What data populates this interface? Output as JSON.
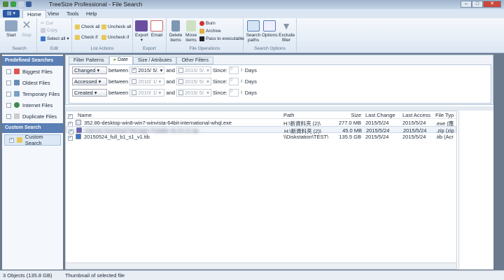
{
  "window": {
    "title": "TreeSize Professional - File Search"
  },
  "ribbon_tabs": [
    "Home",
    "View",
    "Tools",
    "Help"
  ],
  "ribbon": {
    "search": {
      "label": "Search",
      "start": "Start",
      "stop": "Stop"
    },
    "edit": {
      "label": "Edit",
      "cut": "Cut",
      "copy": "Copy",
      "select_all": "Select all"
    },
    "list_actions": {
      "label": "List Actions",
      "check_all": "Check all",
      "uncheck_all": "Uncheck all",
      "check_if": "Check if",
      "uncheck_if": "Uncheck if"
    },
    "export": {
      "label": "Export",
      "export": "Export",
      "email": "Email"
    },
    "file_ops": {
      "label": "File Operations",
      "delete": "Delete items",
      "move": "Move items",
      "burn": "Burn",
      "archive": "Archive",
      "pass": "Pass to executable"
    },
    "search_options": {
      "label": "Search Options",
      "paths": "Search paths",
      "options": "Options",
      "exclude": "Exclude filter"
    }
  },
  "sidebar": {
    "predefined_header": "Predefined Searches",
    "predefined": [
      "Biggest Files",
      "Oldest Files",
      "Temporary Files",
      "Internet Files",
      "Duplicate Files"
    ],
    "custom_header": "Custom Search",
    "custom": [
      "Custom Search"
    ]
  },
  "filter_tabs": [
    "Filter Patterns",
    "Date",
    "Size / Attributes",
    "Other Filters"
  ],
  "date_filters": [
    {
      "type": "Changed",
      "between": "between",
      "from": "2015/  5/.",
      "from_checked": true,
      "and": "and",
      "to": "2015/  5/.",
      "since": "Since:",
      "days_val": "0",
      "days": "Days"
    },
    {
      "type": "Accessed",
      "between": "between",
      "from": "2010/  1/",
      "from_checked": false,
      "and": "and",
      "to": "2015/  5/.",
      "since": "Since:",
      "days_val": "0",
      "days": "Days"
    },
    {
      "type": "Created",
      "between": "between",
      "from": "2010/  1/",
      "from_checked": false,
      "and": "and",
      "to": "2015/  5/.",
      "since": "Since:",
      "days_val": "0",
      "days": "Days"
    }
  ],
  "columns": [
    "Name",
    "Path",
    "Size",
    "Last Change",
    "Last Access",
    "File Typ"
  ],
  "rows": [
    {
      "name": "352.86-desktop-win8-win7-winvista-64bit-international-whql.exe",
      "path": "H:\\新資料夾 (2)\\",
      "size": "277.0 MB",
      "change": "2015/5/24",
      "access": "2015/5/24",
      "type": ".exe (應"
    },
    {
      "name": "Internet Download Manager Potable v6.23.12.zip",
      "path": "H:\\新資料夾 (2)\\",
      "size": "45.0 MB",
      "change": "2015/5/24",
      "access": "2015/5/24",
      "type": ".zip (zip"
    },
    {
      "name": "20150524_full_b1_s1_v1.tib",
      "path": "\\\\Diskstation\\TEST\\",
      "size": "135.5 GB",
      "change": "2015/5/24",
      "access": "2015/5/24",
      "type": ".tib (Acr"
    }
  ],
  "status": {
    "objects": "3 Objects (135.8 GB)",
    "thumbnail": "Thumbnail of selected file"
  }
}
